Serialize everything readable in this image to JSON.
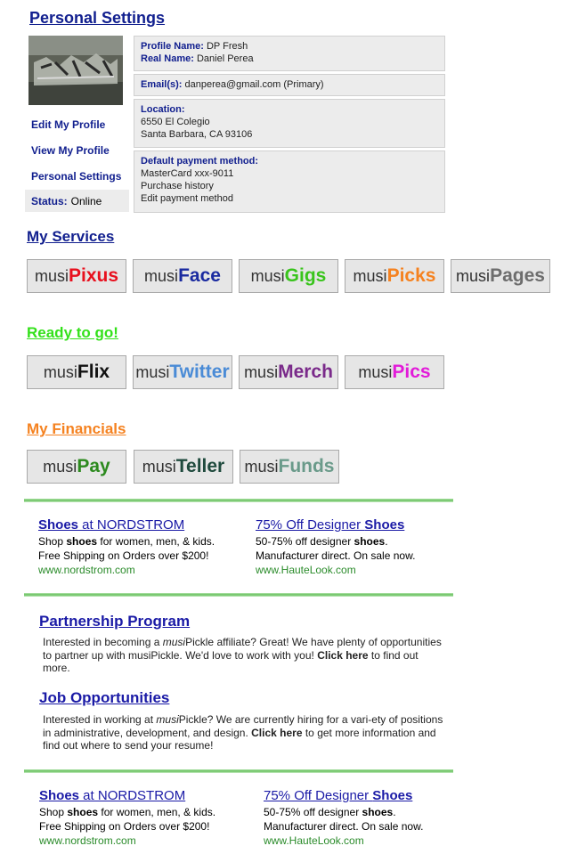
{
  "page_title": "Personal Settings",
  "profile": {
    "name_label": "Profile Name:",
    "name": "DP Fresh",
    "real_label": "Real Name:",
    "real": "Daniel Perea",
    "email_label": "Email(s):",
    "email": "danperea@gmail.com (Primary)",
    "location_label": "Location:",
    "address1": "6550 El Colegio",
    "address2": "Santa Barbara, CA 93106",
    "payment_label": "Default payment method:",
    "card": "MasterCard xxx-9011",
    "history": "Purchase history",
    "edit_payment": "Edit payment method"
  },
  "nav": {
    "edit": "Edit My Profile",
    "view": "View My Profile",
    "personal": "Personal Settings",
    "status_label": "Status:",
    "status_value": "Online"
  },
  "sections": {
    "services": "My Services",
    "ready": "Ready to go!",
    "financials": "My Financials"
  },
  "services": [
    {
      "prefix": "musi",
      "suffix": "Pixus",
      "color": "#e8101e"
    },
    {
      "prefix": "musi",
      "suffix": "Face",
      "color": "#1a2aa0"
    },
    {
      "prefix": "musi",
      "suffix": "Gigs",
      "color": "#39c41c"
    },
    {
      "prefix": "musi",
      "suffix": "Picks",
      "color": "#f58220"
    },
    {
      "prefix": "musi",
      "suffix": "Pages",
      "color": "#6d6d6d"
    }
  ],
  "ready": [
    {
      "prefix": "musi",
      "suffix": "Flix",
      "color": "#111111"
    },
    {
      "prefix": "musi",
      "suffix": "Twitter",
      "color": "#4a8bd6"
    },
    {
      "prefix": "musi",
      "suffix": "Merch",
      "color": "#7a2a8a"
    },
    {
      "prefix": "musi",
      "suffix": "Pics",
      "color": "#e21bd9"
    }
  ],
  "financials": [
    {
      "prefix": "musi",
      "suffix": "Pay",
      "color": "#2c8a1e"
    },
    {
      "prefix": "musi",
      "suffix": "Teller",
      "color": "#1f4a3d"
    },
    {
      "prefix": "musi",
      "suffix": "Funds",
      "color": "#6a9a8a"
    }
  ],
  "ads1": [
    {
      "t1": "Shoes",
      "t2": " at NORDSTROM",
      "l1a": "Shop ",
      "l1b": "shoes",
      "l1c": " for women, men, & kids.",
      "l2": "Free Shipping on Orders over $200!",
      "url": "www.nordstrom.com"
    },
    {
      "t1": "75% Off Designer ",
      "t2": "Shoes",
      "l1a": "50-75% off designer ",
      "l1b": "shoes",
      "l1c": ".",
      "l2": "Manufacturer direct. On sale now.",
      "url": "www.HauteLook.com"
    }
  ],
  "ads2": [
    {
      "t1": "Shoes",
      "t2": " at NORDSTROM",
      "l1a": "Shop ",
      "l1b": "shoes",
      "l1c": " for women, men, & kids.",
      "l2": "Free Shipping on Orders over $200!",
      "url": "www.nordstrom.com"
    },
    {
      "t1": "75% Off Designer ",
      "t2": "Shoes",
      "l1a": "50-75% off designer ",
      "l1b": "shoes",
      "l1c": ".",
      "l2": "Manufacturer direct. On sale now.",
      "url": "www.HauteLook.com"
    }
  ],
  "partnership": {
    "heading": "Partnership Program",
    "a": "Interested in becoming a ",
    "b": "musi",
    "c": "Pickle affiliate? Great! We have plenty of opportunities to partner up with musiPickle. We'd love to work with you! ",
    "d": "Click here",
    "e": " to find out more."
  },
  "jobs": {
    "heading": "Job Opportunities",
    "a": "Interested in working at ",
    "b": "musi",
    "c": "Pickle? We are currently hiring for a vari-ety of positions in administrative, development, and design. ",
    "d": "Click here",
    "e": " to get more information and find out where to send your resume!"
  }
}
